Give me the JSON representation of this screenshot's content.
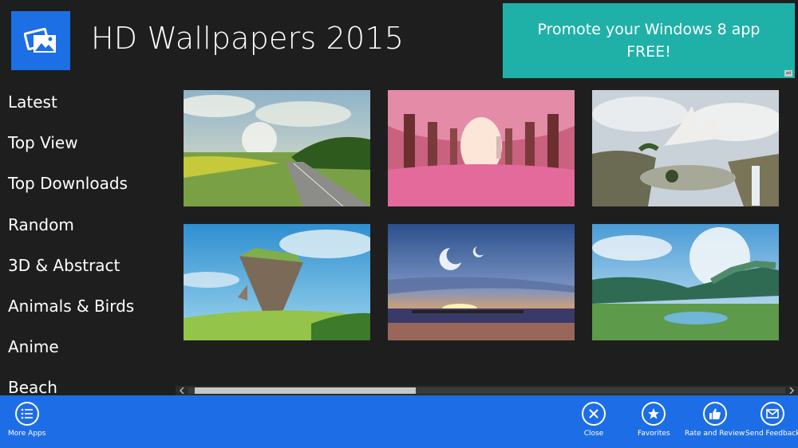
{
  "app": {
    "title": "HD Wallpapers 2015",
    "logo_icon": "photo-gallery-icon"
  },
  "ad": {
    "text": "Promote your Windows 8 app FREE!",
    "badge": "ad"
  },
  "nav": {
    "items": [
      {
        "label": "Latest"
      },
      {
        "label": "Top View"
      },
      {
        "label": "Top Downloads"
      },
      {
        "label": "Random"
      },
      {
        "label": "3D & Abstract"
      },
      {
        "label": "Animals & Birds"
      },
      {
        "label": "Anime"
      },
      {
        "label": "Beach"
      }
    ]
  },
  "wallpapers": [
    {
      "subject": "road-through-fields-with-planet"
    },
    {
      "subject": "pink-blossom-tree-tunnel"
    },
    {
      "subject": "fantasy-city-on-cliffs"
    },
    {
      "subject": "floating-island"
    },
    {
      "subject": "sunset-pier-with-moons"
    },
    {
      "subject": "planet-over-hand-shaped-land"
    }
  ],
  "scrollbar": {
    "position": 0.0,
    "visible_fraction": 0.37
  },
  "appbar": {
    "left": [
      {
        "label": "More Apps",
        "icon": "list-icon"
      }
    ],
    "right": [
      {
        "label": "Close",
        "icon": "close-icon"
      },
      {
        "label": "Favorites",
        "icon": "star-icon"
      },
      {
        "label": "Rate and Review",
        "icon": "thumbs-up-icon"
      },
      {
        "label": "Send Feedback",
        "icon": "mail-icon"
      }
    ]
  },
  "colors": {
    "background": "#1e1e1e",
    "accent": "#1d6ee6",
    "ad_background": "#1fb1a8"
  }
}
